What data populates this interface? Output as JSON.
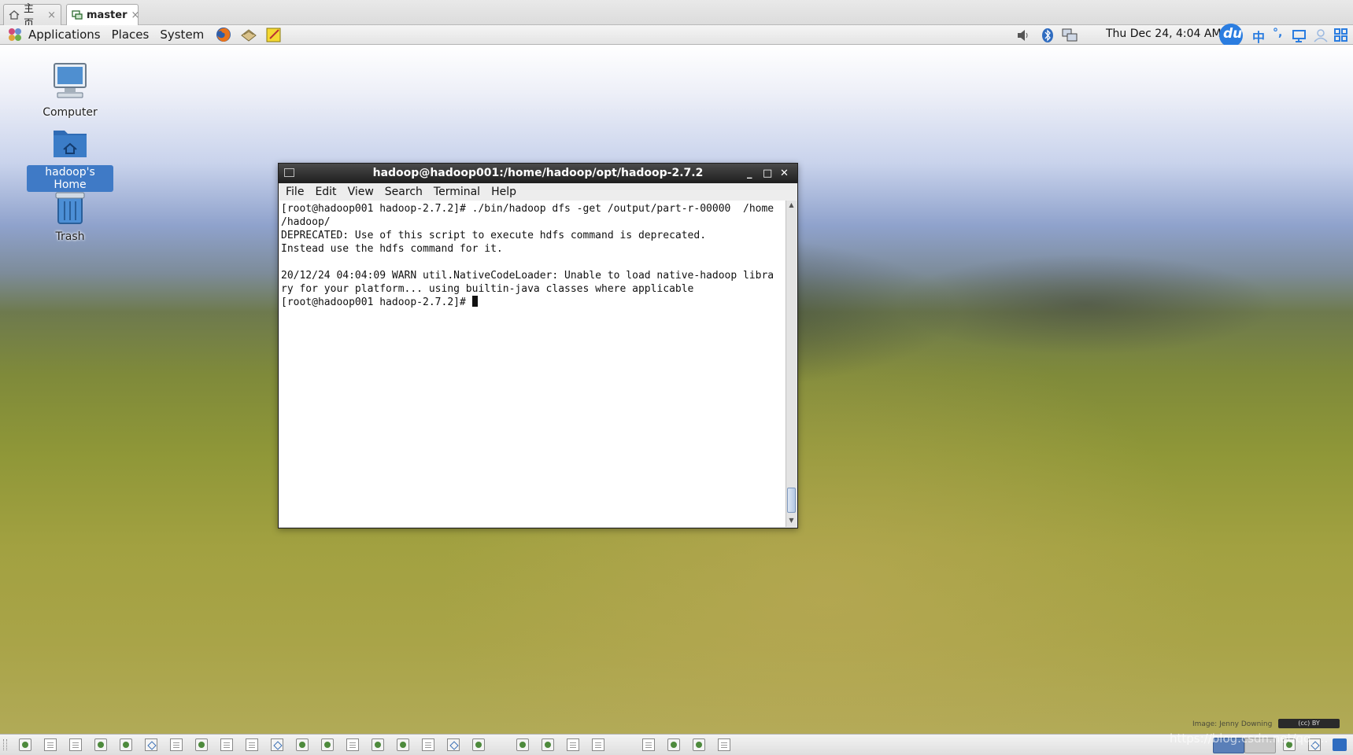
{
  "browser_tabs": [
    {
      "label": "主页",
      "icon": "home-icon",
      "close": "×"
    },
    {
      "label": "master",
      "icon": "vm-icon",
      "close": "×"
    }
  ],
  "top_panel": {
    "menus": [
      "Applications",
      "Places",
      "System"
    ],
    "launchers": [
      "firefox-icon",
      "mail-icon",
      "notes-icon"
    ],
    "clock": "Thu Dec 24,  4:04 AM",
    "tray_icons": [
      "volume-icon",
      "bluetooth-icon",
      "network-icon",
      "baidu-ime-icon",
      "chinese-mode-icon",
      "punctuation-icon",
      "softkeyboard-icon",
      "user-icon",
      "grid-icon"
    ],
    "ime_labels": {
      "baidu": "du",
      "chinese": "中",
      "punct": "°,"
    }
  },
  "desktop": {
    "icons": [
      {
        "label": "Computer",
        "icon": "computer-icon",
        "selected": false
      },
      {
        "label": "hadoop's Home",
        "icon": "home-folder-icon",
        "selected": true
      },
      {
        "label": "Trash",
        "icon": "trash-icon",
        "selected": false
      }
    ],
    "image_credit": "Image: Jenny Downing",
    "cc_badge": "(cc) BY",
    "watermark": "https://blog.csdn.net/qq_..."
  },
  "terminal": {
    "title": "hadoop@hadoop001:/home/hadoop/opt/hadoop-2.7.2",
    "window_buttons": {
      "minimize": "_",
      "maximize": "□",
      "close": "✕"
    },
    "menu": [
      "File",
      "Edit",
      "View",
      "Search",
      "Terminal",
      "Help"
    ],
    "lines": [
      "[root@hadoop001 hadoop-2.7.2]# ./bin/hadoop dfs -get /output/part-r-00000  /home",
      "/hadoop/",
      "DEPRECATED: Use of this script to execute hdfs command is deprecated.",
      "Instead use the hdfs command for it.",
      "",
      "20/12/24 04:04:09 WARN util.NativeCodeLoader: Unable to load native-hadoop libra",
      "ry for your platform... using builtin-java classes where applicable"
    ],
    "prompt": "[root@hadoop001 hadoop-2.7.2]# "
  },
  "bottom_panel": {
    "taskbar_items": [
      "app",
      "doc",
      "doc",
      "app",
      "app",
      "link",
      "doc",
      "app",
      "doc",
      "doc",
      "link",
      "app",
      "app",
      "doc",
      "app",
      "app",
      "doc",
      "link",
      "app",
      "app",
      "app",
      "doc",
      "doc",
      "doc",
      "app",
      "app",
      "doc"
    ]
  }
}
